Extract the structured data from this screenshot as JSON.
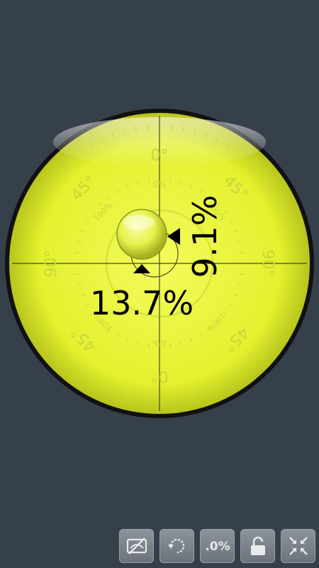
{
  "readings": {
    "horizontal": "13.7%",
    "vertical": "9.1%"
  },
  "scale": {
    "deg0": "0°",
    "deg45": "45°",
    "deg90": "90°",
    "pct0": "0%",
    "pct100": "100%"
  },
  "toolbar": {
    "buttons": [
      {
        "icon": "hide-readings-icon"
      },
      {
        "icon": "rotate-icon"
      },
      {
        "icon": "decimal-toggle-icon",
        "label": ".0%"
      },
      {
        "icon": "unlock-icon"
      },
      {
        "icon": "calibrate-icon"
      }
    ]
  },
  "colors": {
    "background": "#36404b",
    "vial": "#e8f53a",
    "rim": "#111111",
    "button": "#7b8188"
  }
}
